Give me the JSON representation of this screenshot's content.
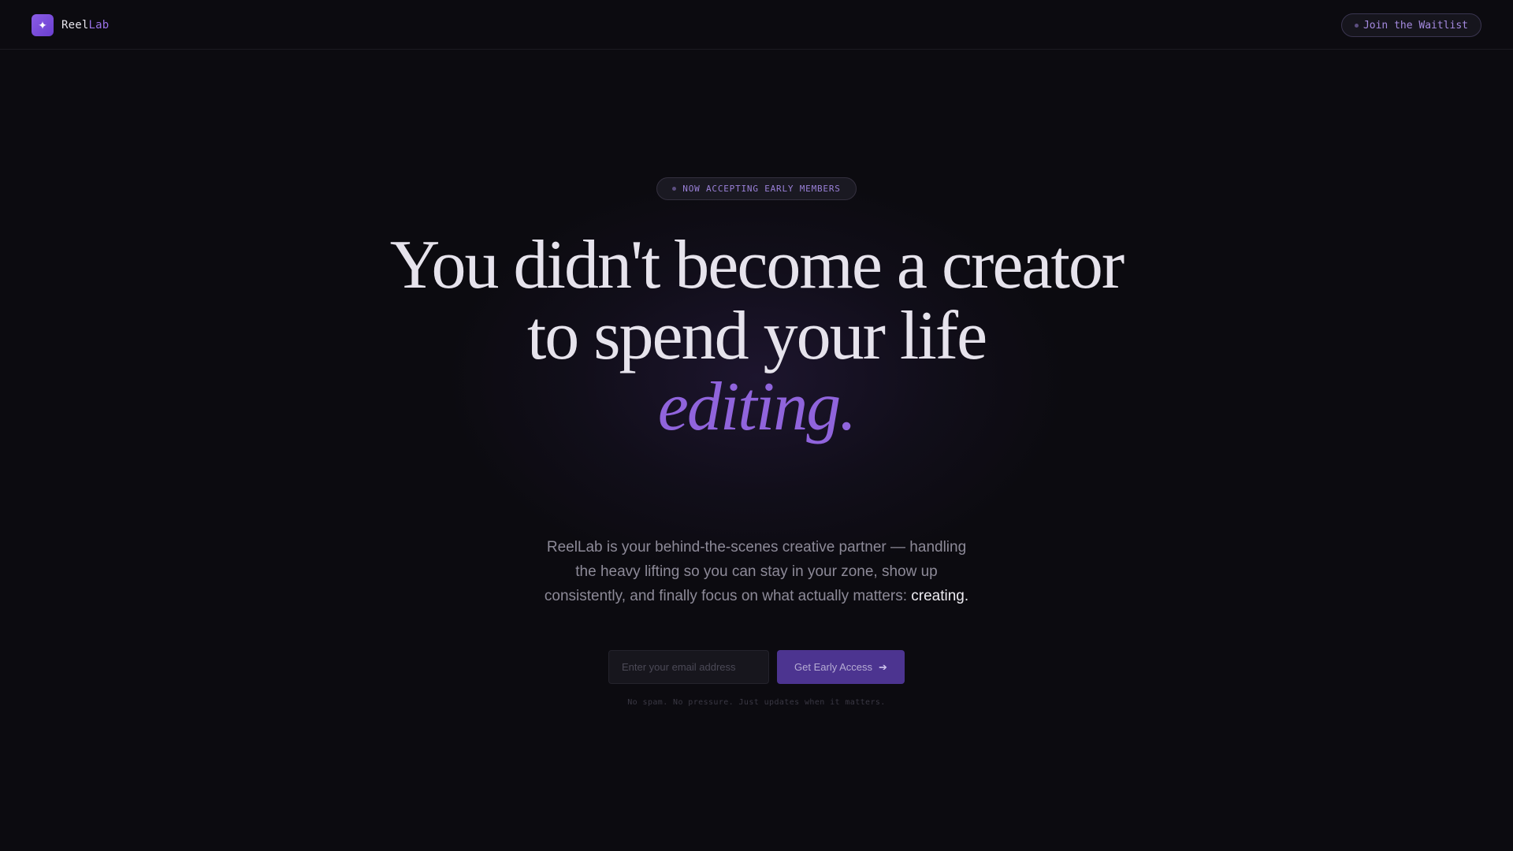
{
  "header": {
    "logo_icon": "sparkle-icon",
    "brand_part1": "Reel",
    "brand_part2": "Lab",
    "cta_label": "Join the Waitlist"
  },
  "hero": {
    "badge": "NOW ACCEPTING EARLY MEMBERS",
    "headline_line1": "You didn't become a creator",
    "headline_line2": "to spend your life",
    "headline_accent": "editing.",
    "subtext": "ReelLab is your behind-the-scenes creative partner — handling the heavy lifting so you can stay in your zone, show up consistently, and finally focus on what actually matters:",
    "subtext_emphasis": "creating."
  },
  "signup": {
    "email_placeholder": "Enter your email address",
    "email_value": "",
    "submit_label": "Get Early Access",
    "submit_icon": "arrow-right-icon",
    "fineprint": "No spam. No pressure. Just updates when it matters."
  },
  "colors": {
    "background": "#0c0b10",
    "accent": "#9064dc",
    "button": "#4c3490",
    "text": "#e6e3ec",
    "muted": "#8d8a98"
  }
}
